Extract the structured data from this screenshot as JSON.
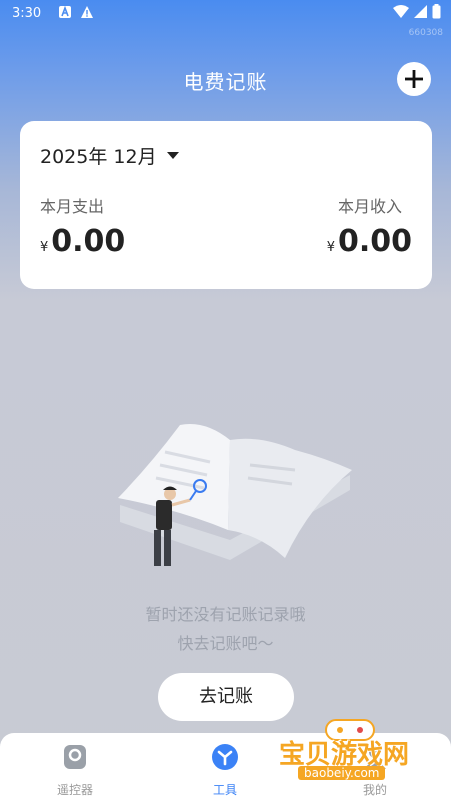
{
  "statusbar": {
    "time": "3:30"
  },
  "top_tag": "660308",
  "header": {
    "title": "电费记账"
  },
  "summary": {
    "month": "2025年 12月",
    "expense_label": "本月支出",
    "income_label": "本月收入",
    "currency": "¥",
    "expense_value": "0.00",
    "income_value": "0.00"
  },
  "empty": {
    "line1": "暂时还没有记账记录哦",
    "line2": "快去记账吧～",
    "button": "去记账"
  },
  "tabs": [
    {
      "label": "遥控器",
      "icon": "remote-icon",
      "active": false
    },
    {
      "label": "工具",
      "icon": "tools-icon",
      "active": true
    },
    {
      "label": "我的",
      "icon": "profile-icon",
      "active": false
    }
  ],
  "watermark": {
    "text": "宝贝游戏网",
    "url": "baobeiy.com"
  },
  "colors": {
    "accent": "#3b82f6",
    "header_blue": "#4a8cf0",
    "watermark": "#f5a623"
  }
}
